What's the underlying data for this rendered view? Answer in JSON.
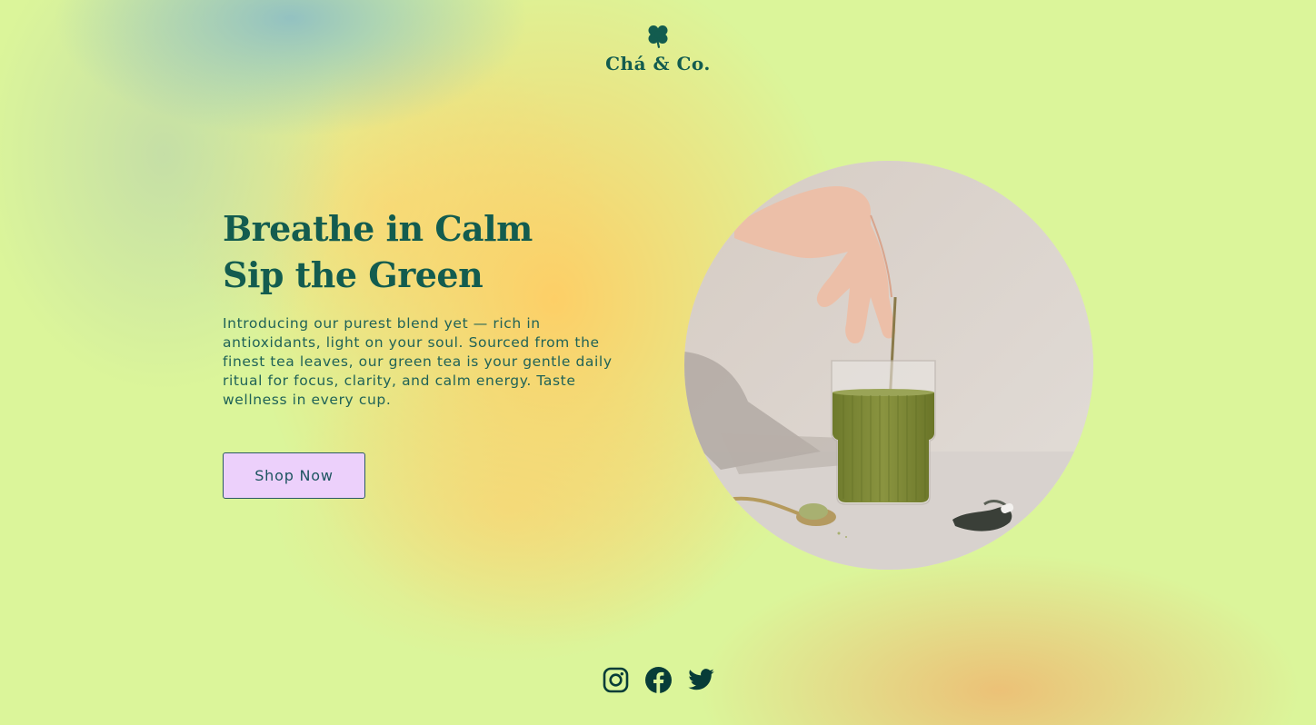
{
  "brand": {
    "name": "Chá & Co.",
    "logo_icon": "clover-icon",
    "color": "#135c4f"
  },
  "hero": {
    "title_line1": "Breathe in Calm",
    "title_line2": "Sip the Green",
    "description": "Introducing our purest blend yet — rich in antioxidants, light on your soul. Sourced from the finest tea leaves, our green tea is your gentle daily ritual for focus, clarity, and calm energy. Taste wellness in every cup.",
    "cta_label": "Shop Now",
    "image_alt": "Hand stirring green matcha tea in a ribbed glass"
  },
  "social": [
    {
      "name": "Instagram",
      "icon": "instagram-icon"
    },
    {
      "name": "Facebook",
      "icon": "facebook-icon"
    },
    {
      "name": "Twitter",
      "icon": "twitter-icon"
    }
  ],
  "colors": {
    "background": "#dbf59a",
    "accent_text": "#135c4f",
    "button_bg": "#ecd0fb",
    "button_border": "#2b5a63"
  }
}
